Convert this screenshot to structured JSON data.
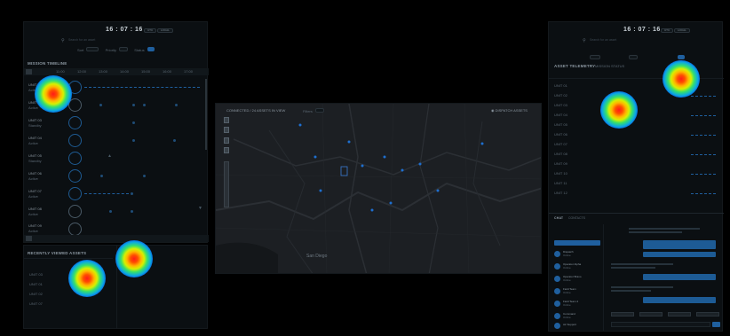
{
  "left_panel": {
    "clock": "16 : 07 : 16",
    "clock_badges": [
      "UTC",
      "LOCAL"
    ],
    "search_placeholder": "Search for an asset",
    "filters": [
      "Sort",
      "Priority",
      "Status",
      "Show"
    ],
    "timeline_title": "MISSION TIMELINE",
    "timeline_ticks": [
      "11:00",
      "12:00",
      "13:00",
      "14:00",
      "15:00",
      "16:00",
      "17:00",
      "18:00"
    ],
    "asset_rows": [
      {
        "name": "UNIT 01",
        "sub": "Active"
      },
      {
        "name": "UNIT 02",
        "sub": "Active"
      },
      {
        "name": "UNIT 03",
        "sub": "Standby"
      },
      {
        "name": "UNIT 04",
        "sub": "Active"
      },
      {
        "name": "UNIT 05",
        "sub": "Standby"
      },
      {
        "name": "UNIT 06",
        "sub": "Active"
      },
      {
        "name": "UNIT 07",
        "sub": "Active"
      },
      {
        "name": "UNIT 08",
        "sub": "Active"
      },
      {
        "name": "UNIT 09",
        "sub": "Active"
      }
    ],
    "recent_title": "RECENTLY VIEWED ASSETS",
    "recent_rows": [
      "UNIT 03",
      "UNIT 01",
      "UNIT 02",
      "UNIT 07"
    ]
  },
  "map": {
    "connected_label": "CONNECTED / 24 ASSETS IN VIEW",
    "filter_label": "Filters",
    "dispatch_label": "DISPATCH ASSETS",
    "city_label": "San Diego"
  },
  "right_panel": {
    "clock": "16 : 07 : 16",
    "clock_badges": [
      "UTC",
      "LOCAL"
    ],
    "search_placeholder": "Search for an asset",
    "telemetry_title": "ASSET TELEMETRY",
    "telemetry_subtitle": "MISSION STATUS",
    "telemetry_rows": [
      "UNIT 01",
      "UNIT 02",
      "UNIT 03",
      "UNIT 04",
      "UNIT 05",
      "UNIT 06",
      "UNIT 07",
      "UNIT 08",
      "UNIT 09",
      "UNIT 10",
      "UNIT 11",
      "UNIT 12"
    ],
    "chat_tabs": [
      "CHAT",
      "CONTACTS"
    ],
    "contacts": [
      {
        "name": "Dispatch",
        "sub": "Online"
      },
      {
        "name": "Operator Alpha",
        "sub": "Online"
      },
      {
        "name": "Operator Bravo",
        "sub": "Online"
      },
      {
        "name": "Field Team",
        "sub": "Online"
      },
      {
        "name": "Field Team 2",
        "sub": "Online"
      },
      {
        "name": "Command",
        "sub": "Online"
      },
      {
        "name": "Air Support",
        "sub": "Online"
      }
    ]
  },
  "colors": {
    "accent": "#1f5f9e",
    "background": "#000000",
    "panel": "#0b0f12"
  }
}
